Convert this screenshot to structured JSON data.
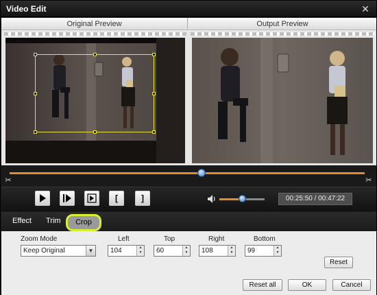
{
  "window": {
    "title": "Video Edit",
    "close_glyph": "✕"
  },
  "preview": {
    "original_label": "Original Preview",
    "output_label": "Output Preview"
  },
  "player": {
    "current_time": "00:25:50",
    "total_time": "00:47:22",
    "time_text": "00:25:50 / 00:47:22",
    "seek_fraction": 0.55,
    "volume_fraction": 0.5,
    "buttons": [
      "play",
      "step-forward",
      "frame-forward",
      "mark-in",
      "mark-out"
    ],
    "mark_in_glyph": "[",
    "mark_out_glyph": "]"
  },
  "tabs": [
    {
      "label": "Effect",
      "selected": false
    },
    {
      "label": "Trim",
      "selected": false
    },
    {
      "label": "Crop",
      "selected": true
    }
  ],
  "crop": {
    "zoom_mode_label": "Zoom Mode",
    "zoom_mode_value": "Keep Original",
    "left_label": "Left",
    "left_value": "104",
    "top_label": "Top",
    "top_value": "60",
    "right_label": "Right",
    "right_value": "108",
    "bottom_label": "Bottom",
    "bottom_value": "99",
    "reset_label": "Reset"
  },
  "footer": {
    "reset_all_label": "Reset all",
    "ok_label": "OK",
    "cancel_label": "Cancel"
  },
  "colors": {
    "accent_orange": "#e8892d",
    "crop_yellow": "#e9e23a",
    "tab_highlight": "#d7ef2d",
    "slider_blue": "#3a7fc4"
  },
  "icons": [
    "close-icon",
    "play-icon",
    "step-forward-icon",
    "frame-forward-icon",
    "mark-in-icon",
    "mark-out-icon",
    "volume-icon",
    "scissors-icon",
    "dropdown-arrow-icon",
    "spin-up-icon",
    "spin-down-icon"
  ]
}
